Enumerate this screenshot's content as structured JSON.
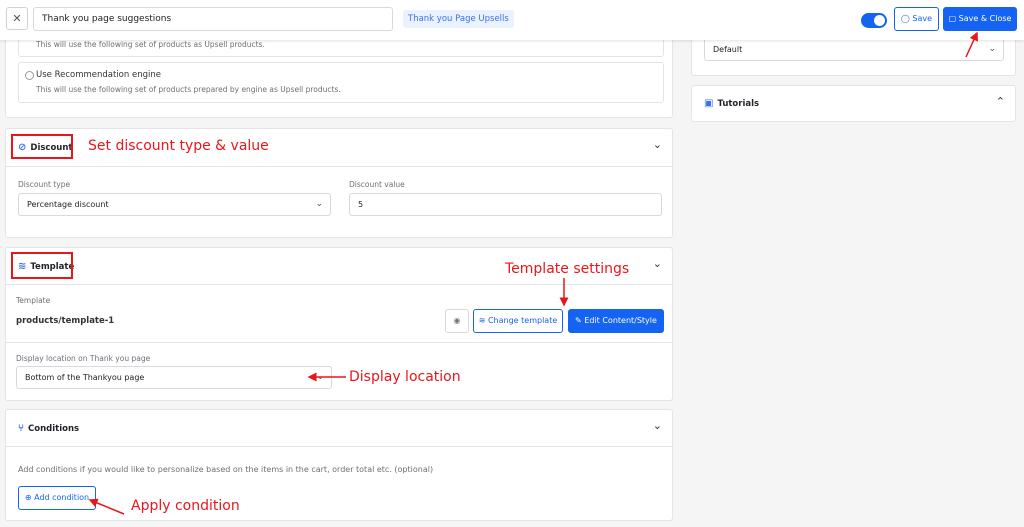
{
  "header": {
    "close_icon": "close-icon",
    "title_value": "Thank you page suggestions",
    "badge": "Thank you Page Upsells",
    "toggle_on": true,
    "save_label": "Save",
    "save_close_label": "Save & Close"
  },
  "products": {
    "option1_desc": "This will use the following set of products as Upsell products.",
    "option2_label": "Use Recommendation engine",
    "option2_desc": "This will use the following set of products prepared by engine as Upsell products."
  },
  "discount": {
    "title": "Discount",
    "type_label": "Discount type",
    "type_value": "Percentage discount",
    "value_label": "Discount value",
    "value": "5"
  },
  "template": {
    "title": "Template",
    "template_label": "Template",
    "template_value": "products/template-1",
    "change_label": "Change template",
    "edit_label": "Edit Content/Style",
    "location_label": "Display location on Thank you page",
    "location_value": "Bottom of the Thankyou page"
  },
  "conditions": {
    "title": "Conditions",
    "desc": "Add conditions if you would like to personalize based on the items in the cart, order total etc. (optional)",
    "add_label": "Add condition"
  },
  "sidebar": {
    "select_value": "Default",
    "tutorials_title": "Tutorials"
  },
  "annotations": {
    "discount": "Set discount type & value",
    "template_settings": "Template settings",
    "display_location": "Display location",
    "apply_condition": "Apply condition"
  },
  "colors": {
    "primary": "#1463f3",
    "annotation": "#e8161b"
  }
}
